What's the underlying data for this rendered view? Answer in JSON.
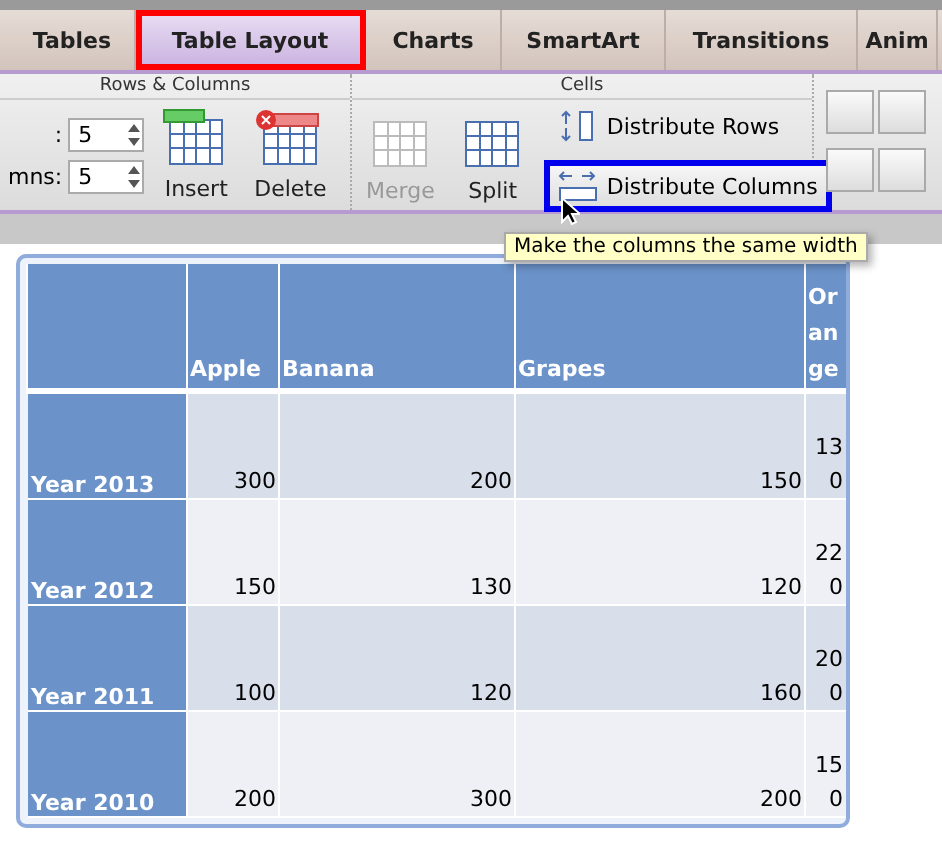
{
  "tabs": [
    {
      "label": "Tables",
      "selected": false,
      "highlighted": false
    },
    {
      "label": "Table Layout",
      "selected": true,
      "highlighted": true
    },
    {
      "label": "Charts",
      "selected": false,
      "highlighted": false
    },
    {
      "label": "SmartArt",
      "selected": false,
      "highlighted": false
    },
    {
      "label": "Transitions",
      "selected": false,
      "highlighted": false
    },
    {
      "label": "Anim",
      "selected": false,
      "highlighted": false
    }
  ],
  "ribbon": {
    "groups": [
      {
        "title": "Rows & Columns"
      },
      {
        "title": "Cells"
      }
    ],
    "spinners": [
      {
        "label": ":",
        "value": "5"
      },
      {
        "label": "mns:",
        "value": "5"
      }
    ],
    "buttons": [
      {
        "label": "Insert",
        "kind": "insert",
        "disabled": false
      },
      {
        "label": "Delete",
        "kind": "delete",
        "disabled": false
      },
      {
        "label": "Merge",
        "kind": "merge",
        "disabled": true
      },
      {
        "label": "Split",
        "kind": "split",
        "disabled": false
      }
    ],
    "distribute": [
      {
        "label": "Distribute Rows",
        "kind": "rows",
        "highlighted": false
      },
      {
        "label": "Distribute Columns",
        "kind": "columns",
        "highlighted": true
      }
    ]
  },
  "tooltip": "Make the columns the same width",
  "table": {
    "columns": [
      "",
      "Apple",
      "Banana",
      "Grapes",
      "Orange"
    ],
    "rows": [
      {
        "cells": [
          "Year 2013",
          "300",
          "200",
          "150",
          "130"
        ]
      },
      {
        "cells": [
          "Year 2012",
          "150",
          "130",
          "120",
          "220"
        ]
      },
      {
        "cells": [
          "Year 2011",
          "100",
          "120",
          "160",
          "200"
        ]
      },
      {
        "cells": [
          "Year 2010",
          "200",
          "300",
          "200",
          "150"
        ]
      }
    ]
  }
}
